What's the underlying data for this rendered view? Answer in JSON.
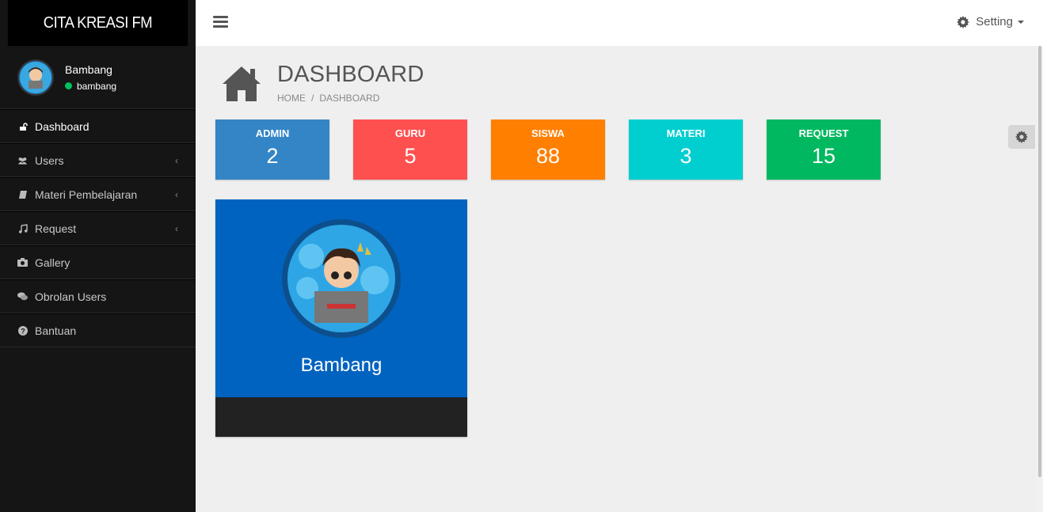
{
  "brand": "CITA KREASI FM",
  "user": {
    "name": "Bambang",
    "username": "bambang",
    "status_color": "#00c060"
  },
  "sidebar": {
    "items": [
      {
        "label": "Dashboard",
        "icon": "unlock-icon",
        "active": true
      },
      {
        "label": "Users",
        "icon": "users-icon",
        "has_children": true
      },
      {
        "label": "Materi Pembelajaran",
        "icon": "book-icon",
        "has_children": true
      },
      {
        "label": "Request",
        "icon": "music-icon",
        "has_children": true
      },
      {
        "label": "Gallery",
        "icon": "camera-icon"
      },
      {
        "label": "Obrolan Users",
        "icon": "comments-icon"
      },
      {
        "label": "Bantuan",
        "icon": "question-circle-icon"
      }
    ],
    "chevron": "‹"
  },
  "topbar": {
    "setting_label": "Setting"
  },
  "page": {
    "title": "DASHBOARD",
    "breadcrumb": [
      "HOME",
      "DASHBOARD"
    ],
    "breadcrumb_sep": "/"
  },
  "stats": [
    {
      "label": "ADMIN",
      "value": "2",
      "color": "#3385c6"
    },
    {
      "label": "GURU",
      "value": "5",
      "color": "#ff5050"
    },
    {
      "label": "SISWA",
      "value": "88",
      "color": "#ff7f00"
    },
    {
      "label": "MATERI",
      "value": "3",
      "color": "#00cecf"
    },
    {
      "label": "REQUEST",
      "value": "15",
      "color": "#00b860"
    }
  ],
  "card": {
    "name": "Bambang",
    "top_color": "#0063bf",
    "bottom_color": "#222222"
  }
}
